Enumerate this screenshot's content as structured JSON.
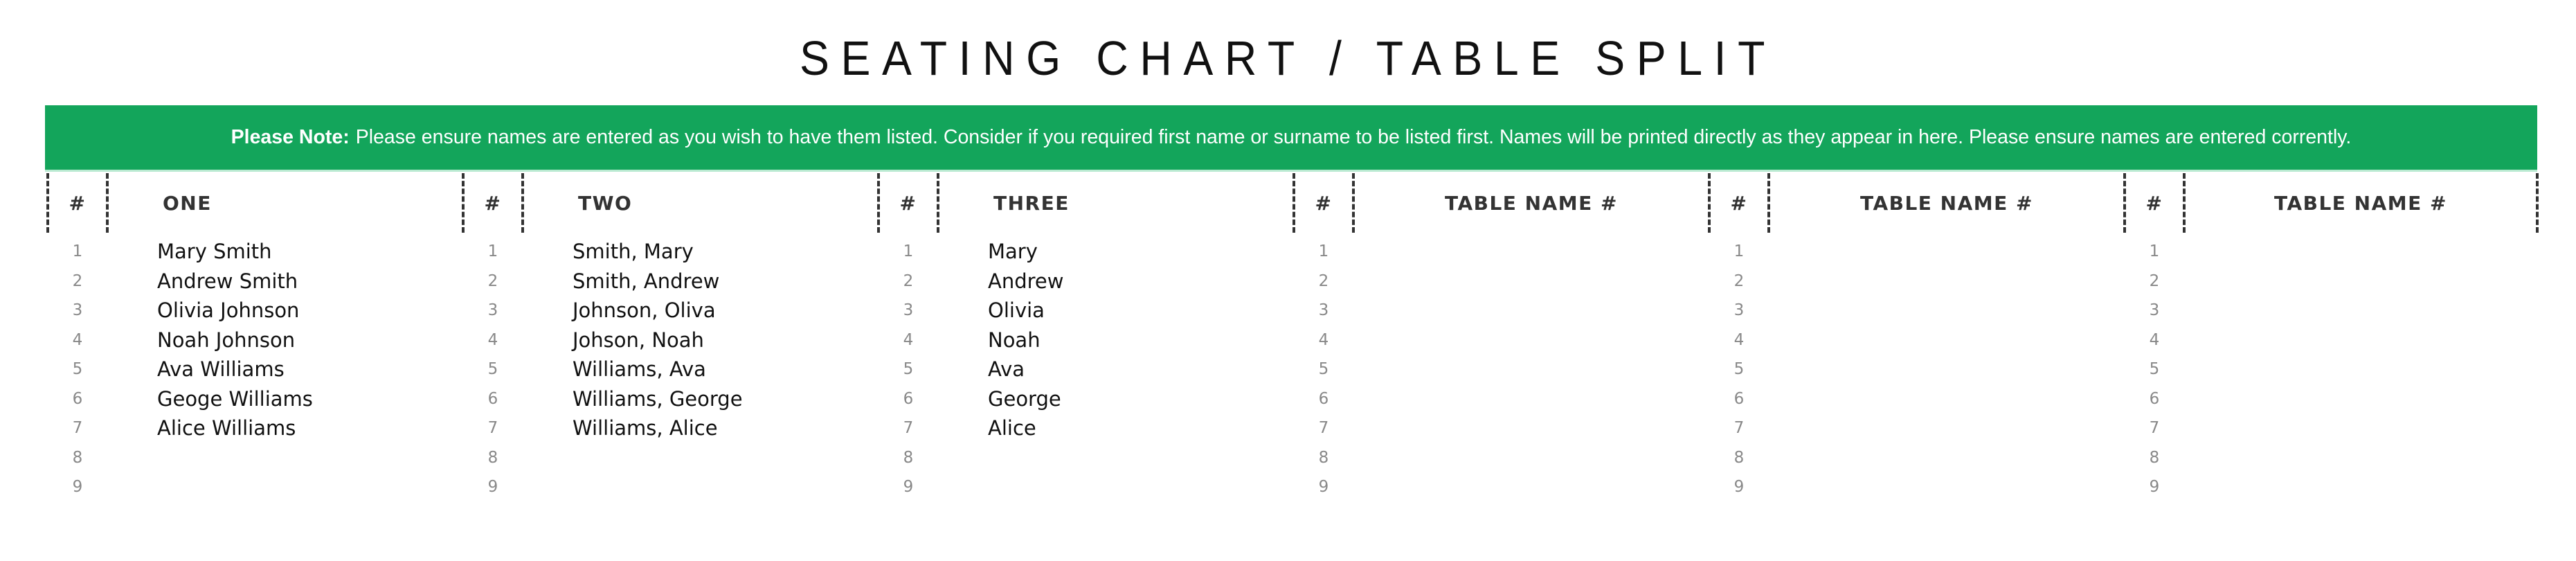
{
  "title": "SEATING CHART / TABLE SPLIT",
  "banner": {
    "label": "Please Note:",
    "text": "Please ensure names are entered as you wish to have them listed. Consider if you required first name or surname to be listed first. Names will be printed directly as they appear in here. Please ensure names are entered corrently.",
    "background_color": "#13a55b"
  },
  "number_header": "#",
  "row_numbers": [
    "1",
    "2",
    "3",
    "4",
    "5",
    "6",
    "7",
    "8",
    "9"
  ],
  "tables": [
    {
      "name": "ONE",
      "guests": [
        "Mary Smith",
        "Andrew Smith",
        "Olivia Johnson",
        "Noah Johnson",
        "Ava Williams",
        "Geoge Williams",
        "Alice Williams",
        "",
        ""
      ]
    },
    {
      "name": "TWO",
      "guests": [
        "Smith, Mary",
        "Smith, Andrew",
        "Johnson, Oliva",
        "Johson, Noah",
        "Williams, Ava",
        "Williams, George",
        "Williams, Alice",
        "",
        ""
      ]
    },
    {
      "name": "THREE",
      "guests": [
        "Mary",
        "Andrew",
        "Olivia",
        "Noah",
        "Ava",
        "George",
        "Alice",
        "",
        ""
      ]
    },
    {
      "name": "TABLE NAME #",
      "guests": [
        "",
        "",
        "",
        "",
        "",
        "",
        "",
        "",
        ""
      ]
    },
    {
      "name": "TABLE NAME #",
      "guests": [
        "",
        "",
        "",
        "",
        "",
        "",
        "",
        "",
        ""
      ]
    },
    {
      "name": "TABLE NAME #",
      "guests": [
        "",
        "",
        "",
        "",
        "",
        "",
        "",
        "",
        ""
      ]
    }
  ]
}
